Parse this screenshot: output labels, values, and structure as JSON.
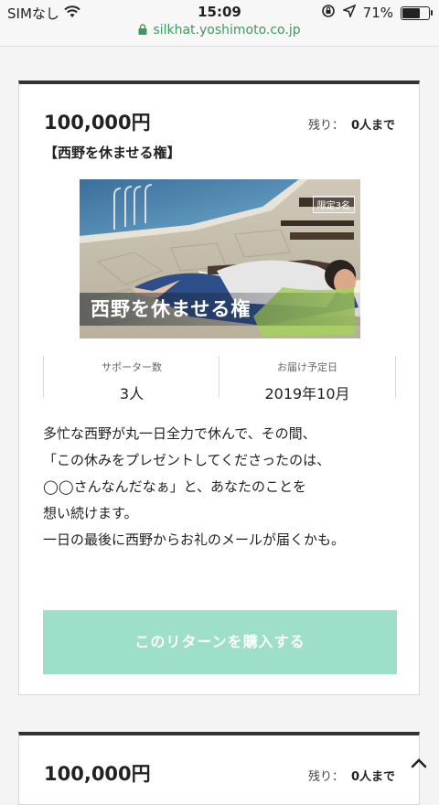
{
  "status_bar": {
    "carrier": "SIMなし",
    "time": "15:09",
    "battery_percent": "71%",
    "battery_level": 0.71
  },
  "browser": {
    "url": "silkhat.yoshimoto.co.jp"
  },
  "colors": {
    "accent": "#9ddfc9",
    "url_green": "#3a9b5d"
  },
  "returns": [
    {
      "price": "100,000円",
      "remaining_label": "残り：",
      "remaining_value": "0人まで",
      "title": "【西野を休ませる権】",
      "image": {
        "badge": "限定3名",
        "caption": "西野を休ませる権"
      },
      "stats": [
        {
          "label": "サポーター数",
          "value": "3人"
        },
        {
          "label": "お届け予定日",
          "value": "2019年10月"
        }
      ],
      "description": [
        "多忙な西野が丸一日全力で休んで、その間、",
        "「この休みをプレゼントしてくださったのは、",
        "◯◯さんなんだなぁ」と、あなたのことを",
        "想い続けます。",
        "一日の最後に西野からお礼のメールが届くかも。"
      ],
      "button_label": "このリターンを購入する"
    },
    {
      "price": "100,000円",
      "remaining_label": "残り：",
      "remaining_value": "0人まで"
    }
  ],
  "icons": {
    "scroll_top": "chevron-up-icon"
  }
}
